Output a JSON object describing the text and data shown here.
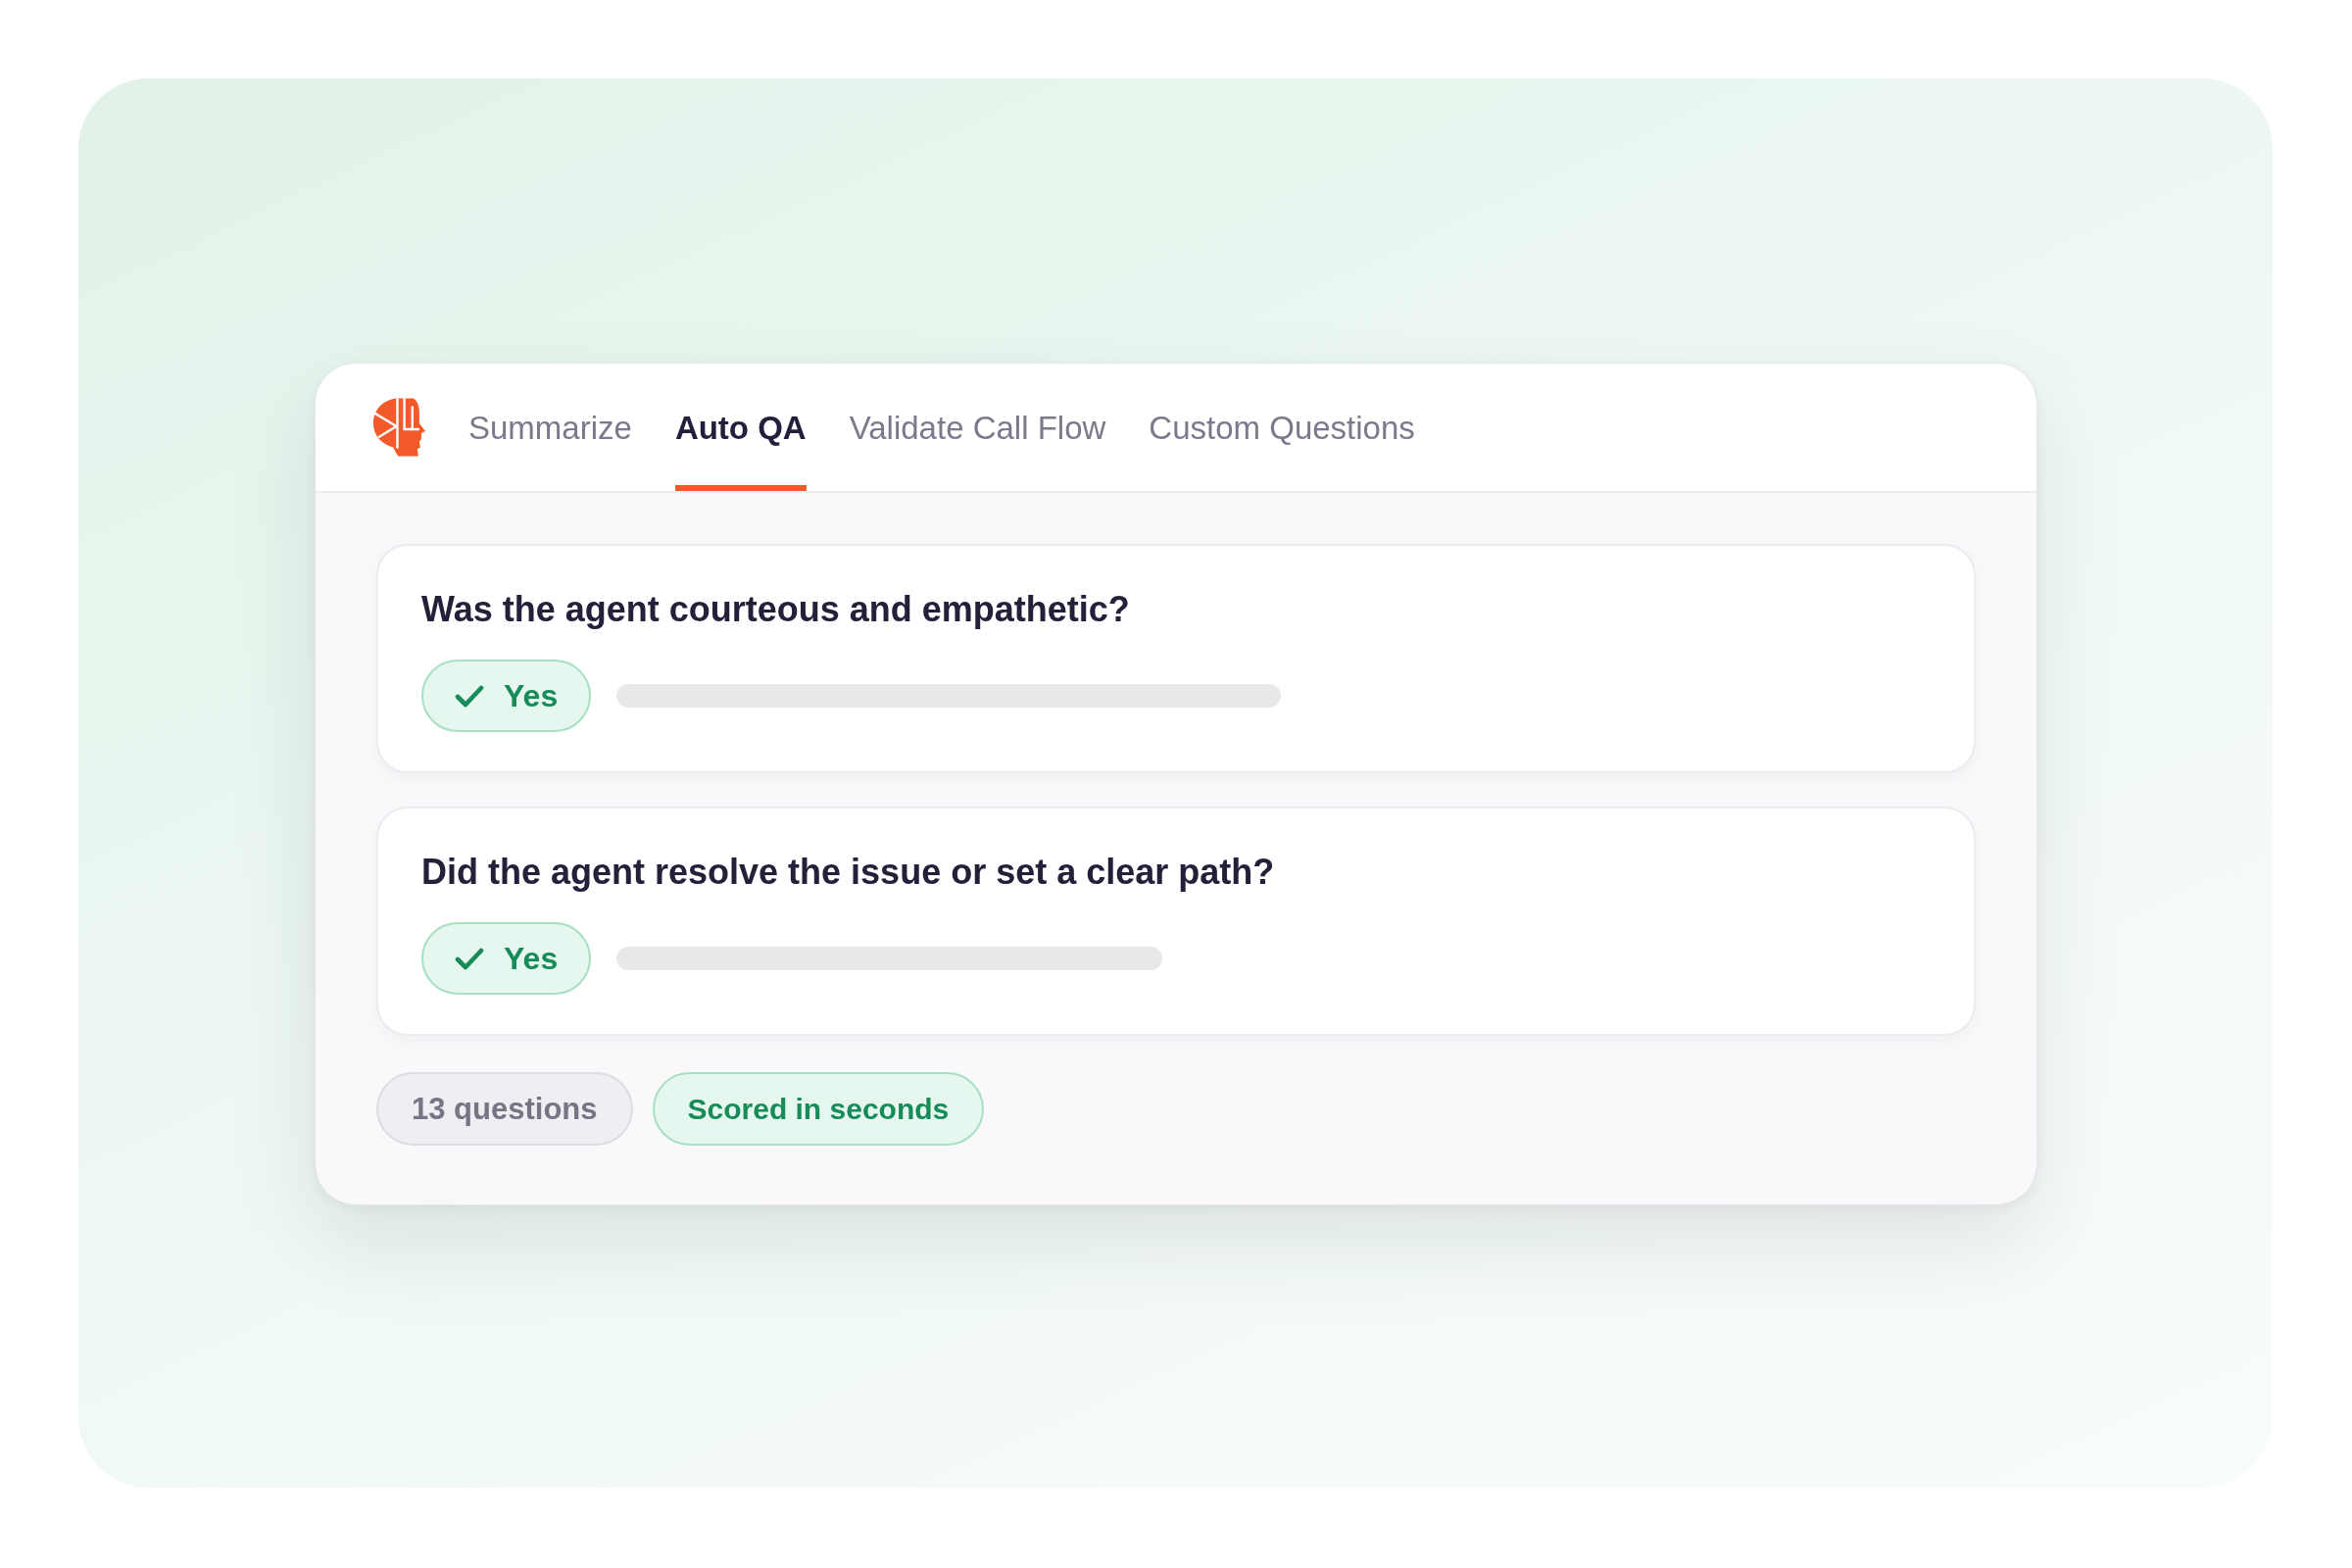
{
  "tabs": [
    {
      "label": "Summarize",
      "selected": false
    },
    {
      "label": "Auto QA",
      "selected": true
    },
    {
      "label": "Validate Call Flow",
      "selected": false
    },
    {
      "label": "Custom Questions",
      "selected": false
    }
  ],
  "questions": [
    {
      "text": "Was the agent courteous and empathetic?",
      "answer": "Yes"
    },
    {
      "text": "Did the agent resolve the issue or set a clear path?",
      "answer": "Yes"
    }
  ],
  "tags": [
    {
      "label": "13 questions",
      "kind": "neutral"
    },
    {
      "label": "Scored in seconds",
      "kind": "success"
    }
  ]
}
